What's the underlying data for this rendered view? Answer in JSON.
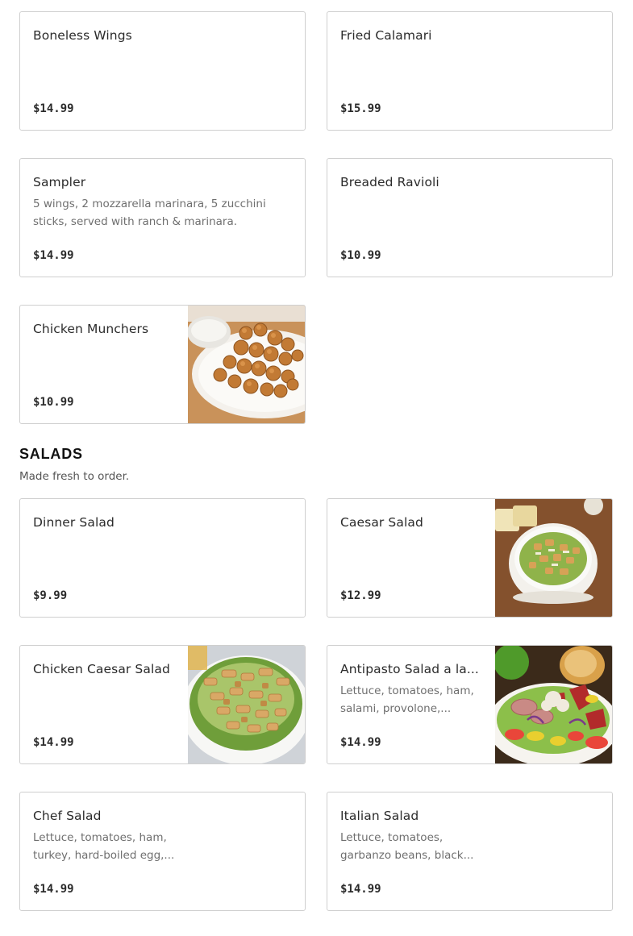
{
  "appetizers": {
    "items": [
      {
        "name": "Boneless Wings",
        "desc": "",
        "price": "$14.99"
      },
      {
        "name": "Fried Calamari",
        "desc": "",
        "price": "$15.99"
      },
      {
        "name": "Sampler",
        "desc": "5 wings, 2 mozzarella marinara, 5 zucchini sticks, served with ranch & marinara.",
        "price": "$14.99"
      },
      {
        "name": "Breaded Ravioli",
        "desc": "",
        "price": "$10.99"
      },
      {
        "name": "Chicken Munchers",
        "desc": "",
        "price": "$10.99",
        "image": "chicken-bites-photo"
      }
    ]
  },
  "salads": {
    "title": "SALADS",
    "subtitle": "Made fresh to order.",
    "items": [
      {
        "name": "Dinner Salad",
        "desc": "",
        "price": "$9.99"
      },
      {
        "name": "Caesar Salad",
        "desc": "",
        "price": "$12.99",
        "image": "caesar-salad-photo"
      },
      {
        "name": "Chicken Caesar Salad",
        "desc": "",
        "price": "$14.99",
        "image": "chicken-caesar-photo"
      },
      {
        "name": "Antipasto Salad a la...",
        "desc": "Lettuce, tomatoes, ham, salami, provolone,...",
        "price": "$14.99",
        "image": "antipasto-salad-photo"
      },
      {
        "name": "Chef Salad",
        "desc": "Lettuce, tomatoes, ham, turkey, hard-boiled egg,...",
        "price": "$14.99"
      },
      {
        "name": "Italian Salad",
        "desc": "Lettuce, tomatoes, garbanzo beans, black...",
        "price": "$14.99"
      }
    ]
  }
}
